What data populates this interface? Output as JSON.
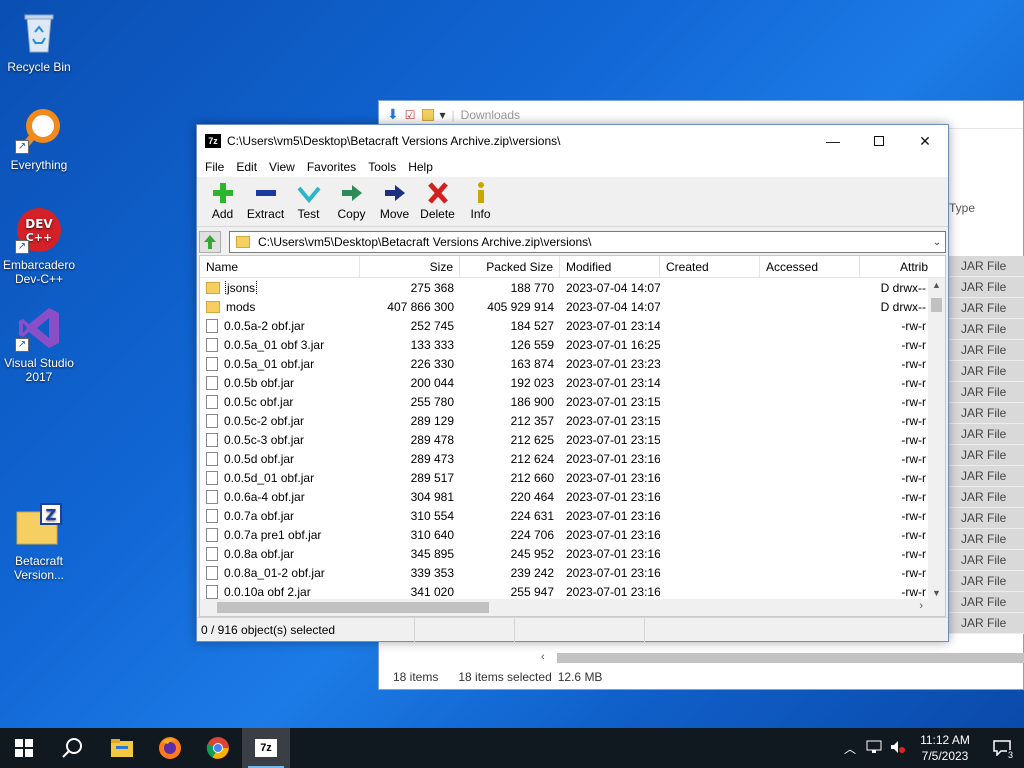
{
  "desktop": {
    "icons": [
      {
        "label": "Recycle Bin"
      },
      {
        "label": "Everything"
      },
      {
        "label": "Embarcadero Dev-C++"
      },
      {
        "label": "Visual Studio 2017"
      },
      {
        "label": "Betacraft Version..."
      }
    ]
  },
  "explorer_bg": {
    "address": "Downloads",
    "type_header": "Type",
    "type_values": [
      "JAR File",
      "JAR File",
      "JAR File",
      "JAR File",
      "JAR File",
      "JAR File",
      "JAR File",
      "JAR File",
      "JAR File",
      "JAR File",
      "JAR File",
      "JAR File",
      "JAR File",
      "JAR File",
      "JAR File",
      "JAR File",
      "JAR File",
      "JAR File"
    ],
    "status": {
      "items": "18 items",
      "selected": "18 items selected",
      "size": "12.6 MB"
    }
  },
  "zip": {
    "title": "C:\\Users\\vm5\\Desktop\\Betacraft Versions Archive.zip\\versions\\",
    "menu": [
      "File",
      "Edit",
      "View",
      "Favorites",
      "Tools",
      "Help"
    ],
    "toolbar": {
      "add": "Add",
      "extract": "Extract",
      "test": "Test",
      "copy": "Copy",
      "move": "Move",
      "delete": "Delete",
      "info": "Info"
    },
    "address": "C:\\Users\\vm5\\Desktop\\Betacraft Versions Archive.zip\\versions\\",
    "columns": {
      "name": "Name",
      "size": "Size",
      "packed": "Packed Size",
      "modified": "Modified",
      "created": "Created",
      "accessed": "Accessed",
      "attrib": "Attrib"
    },
    "rows": [
      {
        "name": "jsons",
        "kind": "folder",
        "size": "275 368",
        "packed": "188 770",
        "modified": "2023-07-04 14:07",
        "attrib": "D drwx--"
      },
      {
        "name": "mods",
        "kind": "folder",
        "size": "407 866 300",
        "packed": "405 929 914",
        "modified": "2023-07-04 14:07",
        "attrib": "D drwx--"
      },
      {
        "name": "0.0.5a-2 obf.jar",
        "kind": "file",
        "size": "252 745",
        "packed": "184 527",
        "modified": "2023-07-01 23:14",
        "attrib": "-rw-r"
      },
      {
        "name": "0.0.5a_01 obf 3.jar",
        "kind": "file",
        "size": "133 333",
        "packed": "126 559",
        "modified": "2023-07-01 16:25",
        "attrib": "-rw-r"
      },
      {
        "name": "0.0.5a_01 obf.jar",
        "kind": "file",
        "size": "226 330",
        "packed": "163 874",
        "modified": "2023-07-01 23:23",
        "attrib": "-rw-r"
      },
      {
        "name": "0.0.5b obf.jar",
        "kind": "file",
        "size": "200 044",
        "packed": "192 023",
        "modified": "2023-07-01 23:14",
        "attrib": "-rw-r"
      },
      {
        "name": "0.0.5c obf.jar",
        "kind": "file",
        "size": "255 780",
        "packed": "186 900",
        "modified": "2023-07-01 23:15",
        "attrib": "-rw-r"
      },
      {
        "name": "0.0.5c-2 obf.jar",
        "kind": "file",
        "size": "289 129",
        "packed": "212 357",
        "modified": "2023-07-01 23:15",
        "attrib": "-rw-r"
      },
      {
        "name": "0.0.5c-3 obf.jar",
        "kind": "file",
        "size": "289 478",
        "packed": "212 625",
        "modified": "2023-07-01 23:15",
        "attrib": "-rw-r"
      },
      {
        "name": "0.0.5d obf.jar",
        "kind": "file",
        "size": "289 473",
        "packed": "212 624",
        "modified": "2023-07-01 23:16",
        "attrib": "-rw-r"
      },
      {
        "name": "0.0.5d_01 obf.jar",
        "kind": "file",
        "size": "289 517",
        "packed": "212 660",
        "modified": "2023-07-01 23:16",
        "attrib": "-rw-r"
      },
      {
        "name": "0.0.6a-4 obf.jar",
        "kind": "file",
        "size": "304 981",
        "packed": "220 464",
        "modified": "2023-07-01 23:16",
        "attrib": "-rw-r"
      },
      {
        "name": "0.0.7a obf.jar",
        "kind": "file",
        "size": "310 554",
        "packed": "224 631",
        "modified": "2023-07-01 23:16",
        "attrib": "-rw-r"
      },
      {
        "name": "0.0.7a pre1 obf.jar",
        "kind": "file",
        "size": "310 640",
        "packed": "224 706",
        "modified": "2023-07-01 23:16",
        "attrib": "-rw-r"
      },
      {
        "name": "0.0.8a obf.jar",
        "kind": "file",
        "size": "345 895",
        "packed": "245 952",
        "modified": "2023-07-01 23:16",
        "attrib": "-rw-r"
      },
      {
        "name": "0.0.8a_01-2 obf.jar",
        "kind": "file",
        "size": "339 353",
        "packed": "239 242",
        "modified": "2023-07-01 23:16",
        "attrib": "-rw-r"
      },
      {
        "name": "0.0.10a obf 2.jar",
        "kind": "file",
        "size": "341 020",
        "packed": "255 947",
        "modified": "2023-07-01 23:16",
        "attrib": "-rw-r"
      }
    ],
    "status": "0 / 916 object(s) selected"
  },
  "taskbar": {
    "time": "11:12 AM",
    "date": "7/5/2023",
    "notifications": "3"
  }
}
